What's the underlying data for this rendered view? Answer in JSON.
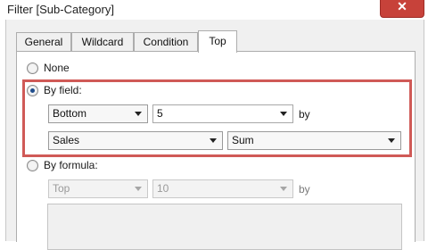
{
  "window": {
    "title": "Filter [Sub-Category]",
    "close_label": "✕"
  },
  "tabs": [
    {
      "label": "General"
    },
    {
      "label": "Wildcard"
    },
    {
      "label": "Condition"
    },
    {
      "label": "Top"
    }
  ],
  "options": {
    "none": {
      "label": "None"
    },
    "by_field": {
      "label": "By field:"
    },
    "by_formula": {
      "label": "By formula:"
    }
  },
  "by_field": {
    "direction": "Bottom",
    "count": "5",
    "by_label": "by",
    "field": "Sales",
    "aggregation": "Sum"
  },
  "by_formula": {
    "direction": "Top",
    "count": "10",
    "by_label": "by"
  },
  "colors": {
    "highlight": "#d05a57",
    "close": "#c7423a"
  }
}
